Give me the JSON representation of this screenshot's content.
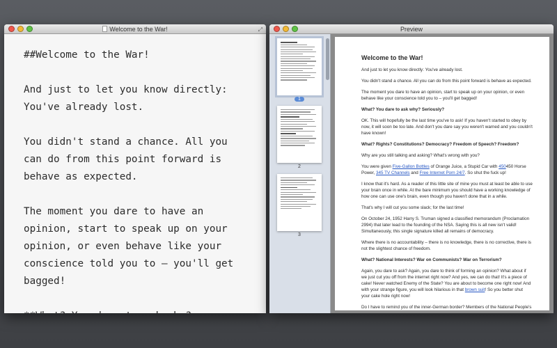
{
  "editor": {
    "title": "Welcome to the War!",
    "paragraphs": [
      "##Welcome to the War!",
      "And just to let you know directly: You've already lost.",
      "You didn't stand a chance. All you can do from this point forward is behave as expected.",
      "The moment you dare to have an opinion, start to speak up on your opinion, or even behave like your conscience told you to – you'll get bagged!",
      "**What? You dare to ask why? Seriously?**"
    ]
  },
  "preview": {
    "title": "Preview",
    "thumbnails": [
      {
        "label": "1",
        "selected": true
      },
      {
        "label": "2",
        "selected": false
      },
      {
        "label": "3",
        "selected": false
      }
    ],
    "page": {
      "heading": "Welcome to the War!",
      "p1": "And just to let you know directly: You've already lost.",
      "p2": "You didn't stand a chance. All you can do from this point forward is behave as expected.",
      "p3": "The moment you dare to have an opinion, start to speak up on your opinion, or even behave like your conscience told you to – you'll get bagged!",
      "h1": "What? You dare to ask why? Seriously?",
      "p4": "OK. This will hopefully be the last time you've to ask! If you haven't started to obey by now, it will soon be too late. And don't you dare say you weren't warned and you couldn't have known!",
      "h2": "What? Rights? Constitutions? Democracy? Freedom of Speech? Freedom?",
      "p5": "Why are you still talking and asking? What's wrong with you?",
      "p6_pre": "You were given ",
      "p6_link1": "Five-Gallon Bottles",
      "p6_mid1": " of Orange Juice, a Stupid Car with ",
      "p6_link2": "450",
      "p6_mid2": "450 Horse Power, ",
      "p6_link3": "345 TV Channels",
      "p6_mid3": " and ",
      "p6_link4": "Free Internet Porn 24/7",
      "p6_post": ". So shut the fuck up!",
      "p7": "I know that it's hard. As a reader of this little site of mine you must at least be able to use your brain once in while. At the bare minimum you should have a working knowledge of how one can use one's brain, even though you haven't done that in a while.",
      "p8": "That's why I will cut you some slack; for the last time!",
      "p9": "On October 24, 1952 Harry S. Truman signed a classified memorandum (Proclamation 2994) that later lead to the founding of the NSA. Saying this is all new isn't valid! Simultaneously, this single signature killed all remains of democracy.",
      "p10": "Where there is no accountability – there is no knowledge, there is no corrective, there is not the slightest chance of freedom.",
      "h3": "What? National Interests? War on Communists? War on Terrorism?",
      "p11_pre": "Again, you dare to ask? Again, you dare to think of forming an opinion? What about if we just cut you off from the internet right now? And yes, we can do that! It's a piece of cake! Never watched Enemy of the State? You are about to become one right now! And with your strange figure, you will look hilarious in that ",
      "p11_link": "brown suit",
      "p11_post": "! So you better shut your cake hole right now!",
      "p12": "Do I have to remind you of the inner-German border? Members of the National People's"
    }
  }
}
